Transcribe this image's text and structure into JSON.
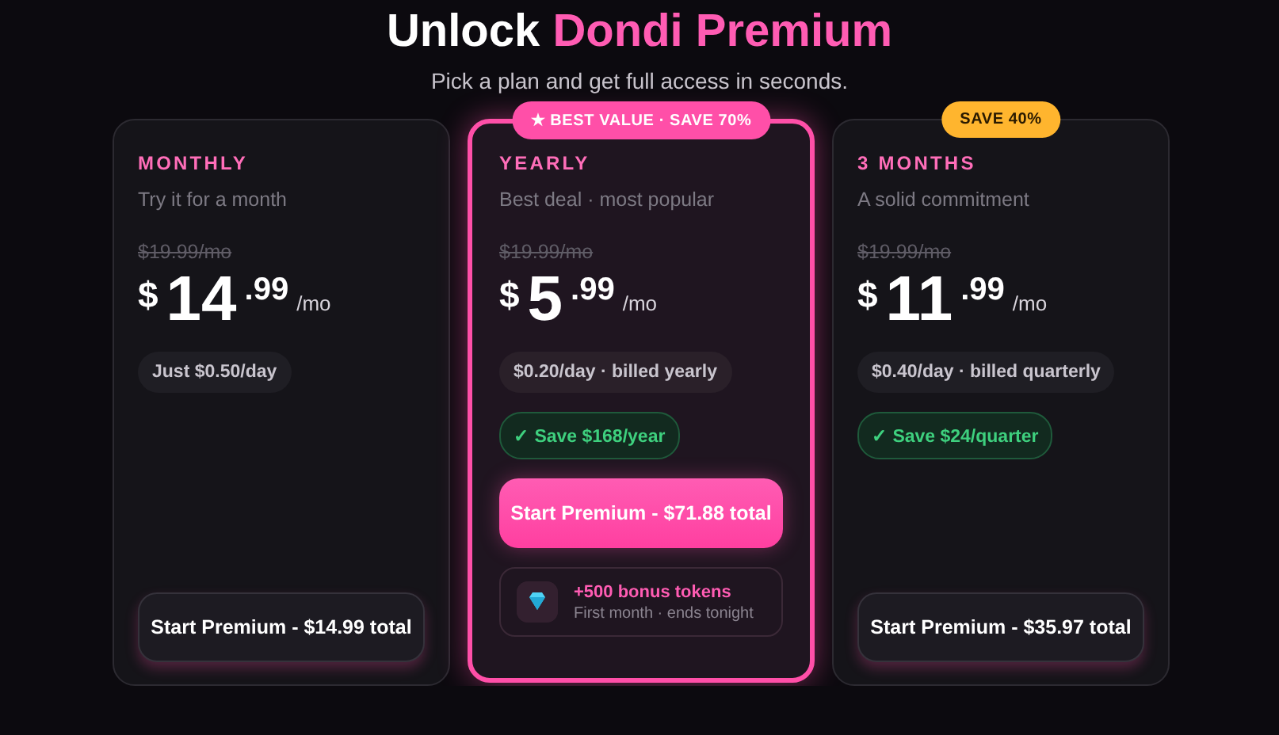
{
  "header": {
    "title_lead": "Unlock",
    "title_highlight": "Dondi Premium",
    "subtitle": "Pick a plan and get full access in seconds."
  },
  "plans": [
    {
      "name": "MONTHLY",
      "tagline": "Try it for a month",
      "old_price": "$19.99/mo",
      "currency": "$",
      "whole": "14",
      "cents": ".99",
      "period": "/mo",
      "per_day": "Just $0.50/day",
      "highlighted": false,
      "button": "Start Premium - $14.99 total"
    },
    {
      "name": "YEARLY",
      "tagline": "Best deal · most popular",
      "old_price": "$19.99/mo",
      "currency": "$",
      "whole": "5",
      "cents": ".99",
      "period": "/mo",
      "per_day": "$0.20/day · billed yearly",
      "highlighted": true,
      "badge": {
        "text": "★ BEST VALUE · SAVE 70%",
        "color": "#ff4fa8"
      },
      "savings": "✓ Save $168/year",
      "button": "Start Premium - $71.88 total",
      "bonus": {
        "title": "+500 bonus tokens",
        "note": "First month · ends tonight"
      }
    },
    {
      "name": "3 MONTHS",
      "tagline": "A solid commitment",
      "old_price": "$19.99/mo",
      "currency": "$",
      "whole": "11",
      "cents": ".99",
      "period": "/mo",
      "per_day": "$0.40/day · billed quarterly",
      "highlighted": false,
      "badge": {
        "text": "SAVE 40%",
        "color": "#ffb52e"
      },
      "savings": "✓ Save $24/quarter",
      "button": "Start Premium - $35.97 total"
    }
  ]
}
